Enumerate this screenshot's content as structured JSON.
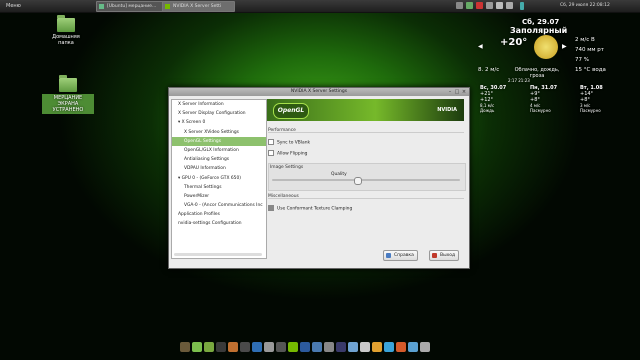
{
  "panel": {
    "menu_label": "Меню",
    "tasks": [
      {
        "label": "[Ubuntu] мерцание..."
      },
      {
        "label": "NVIDIA X Server Setti"
      }
    ],
    "clock": "Сб, 29 июля 22:08:12"
  },
  "desktop": {
    "icon1_label": "Домашняя папка",
    "icon2_label": "МЕРЦАНИЕ ЭКРАНА УСТРАНЕНО"
  },
  "weather": {
    "date": "Сб, 29.07",
    "city": "Заполярный",
    "temp": "+20°",
    "wind": "2 м/с  В",
    "pressure": "740 мм рт",
    "humidity": "77 %",
    "temp_water": "15 °С вода",
    "visibility": "8. 2 м/с",
    "condition": "Облачно, дождь, гроза",
    "forecast": [
      {
        "day": "Вс, 30.07",
        "hi": "+21°",
        "lo": "+12°",
        "wind": "8,1 м/с",
        "text": "Дождь"
      },
      {
        "day": "Пн, 31.07",
        "hi": "+9°",
        "lo": "+8°",
        "wind": "4 м/с",
        "text": "Пасмурно"
      },
      {
        "day": "Вт, 1.08",
        "hi": "+14°",
        "lo": "+8°",
        "wind": "3 м/с",
        "text": "Пасмурно"
      }
    ],
    "sun": "2:17   21:23"
  },
  "window": {
    "title": "NVIDIA X Server Settings",
    "tree": [
      {
        "label": "X Server Information",
        "level": 1
      },
      {
        "label": "X Server Display Configuration",
        "level": 1
      },
      {
        "label": "X Screen 0",
        "level": 1
      },
      {
        "label": "X Server XVideo Settings",
        "level": 2
      },
      {
        "label": "OpenGL Settings",
        "level": 2,
        "selected": true
      },
      {
        "label": "OpenGL/GLX Information",
        "level": 2
      },
      {
        "label": "Antialiasing Settings",
        "level": 2
      },
      {
        "label": "VDPAU Information",
        "level": 2
      },
      {
        "label": "GPU 0 - (GeForce GTX 650)",
        "level": 1
      },
      {
        "label": "Thermal Settings",
        "level": 2
      },
      {
        "label": "PowerMizer",
        "level": 2
      },
      {
        "label": "VGA-0 - (Ancor Communications Inc",
        "level": 2
      },
      {
        "label": "Application Profiles",
        "level": 1
      },
      {
        "label": "nvidia-settings Configuration",
        "level": 1
      }
    ],
    "banner_text": "OpenGL",
    "banner_brand": "NVIDIA",
    "performance_label": "Performance",
    "sync_vblank": "Sync to VBlank",
    "allow_flipping": "Allow Flipping",
    "image_settings_label": "Image Settings",
    "quality_label": "Quality",
    "quality_level": 0.45,
    "misc_label": "Miscellaneous",
    "conformant_texture": "Use Conformant Texture Clamping",
    "help_button": "Справка",
    "quit_button": "Выход"
  }
}
